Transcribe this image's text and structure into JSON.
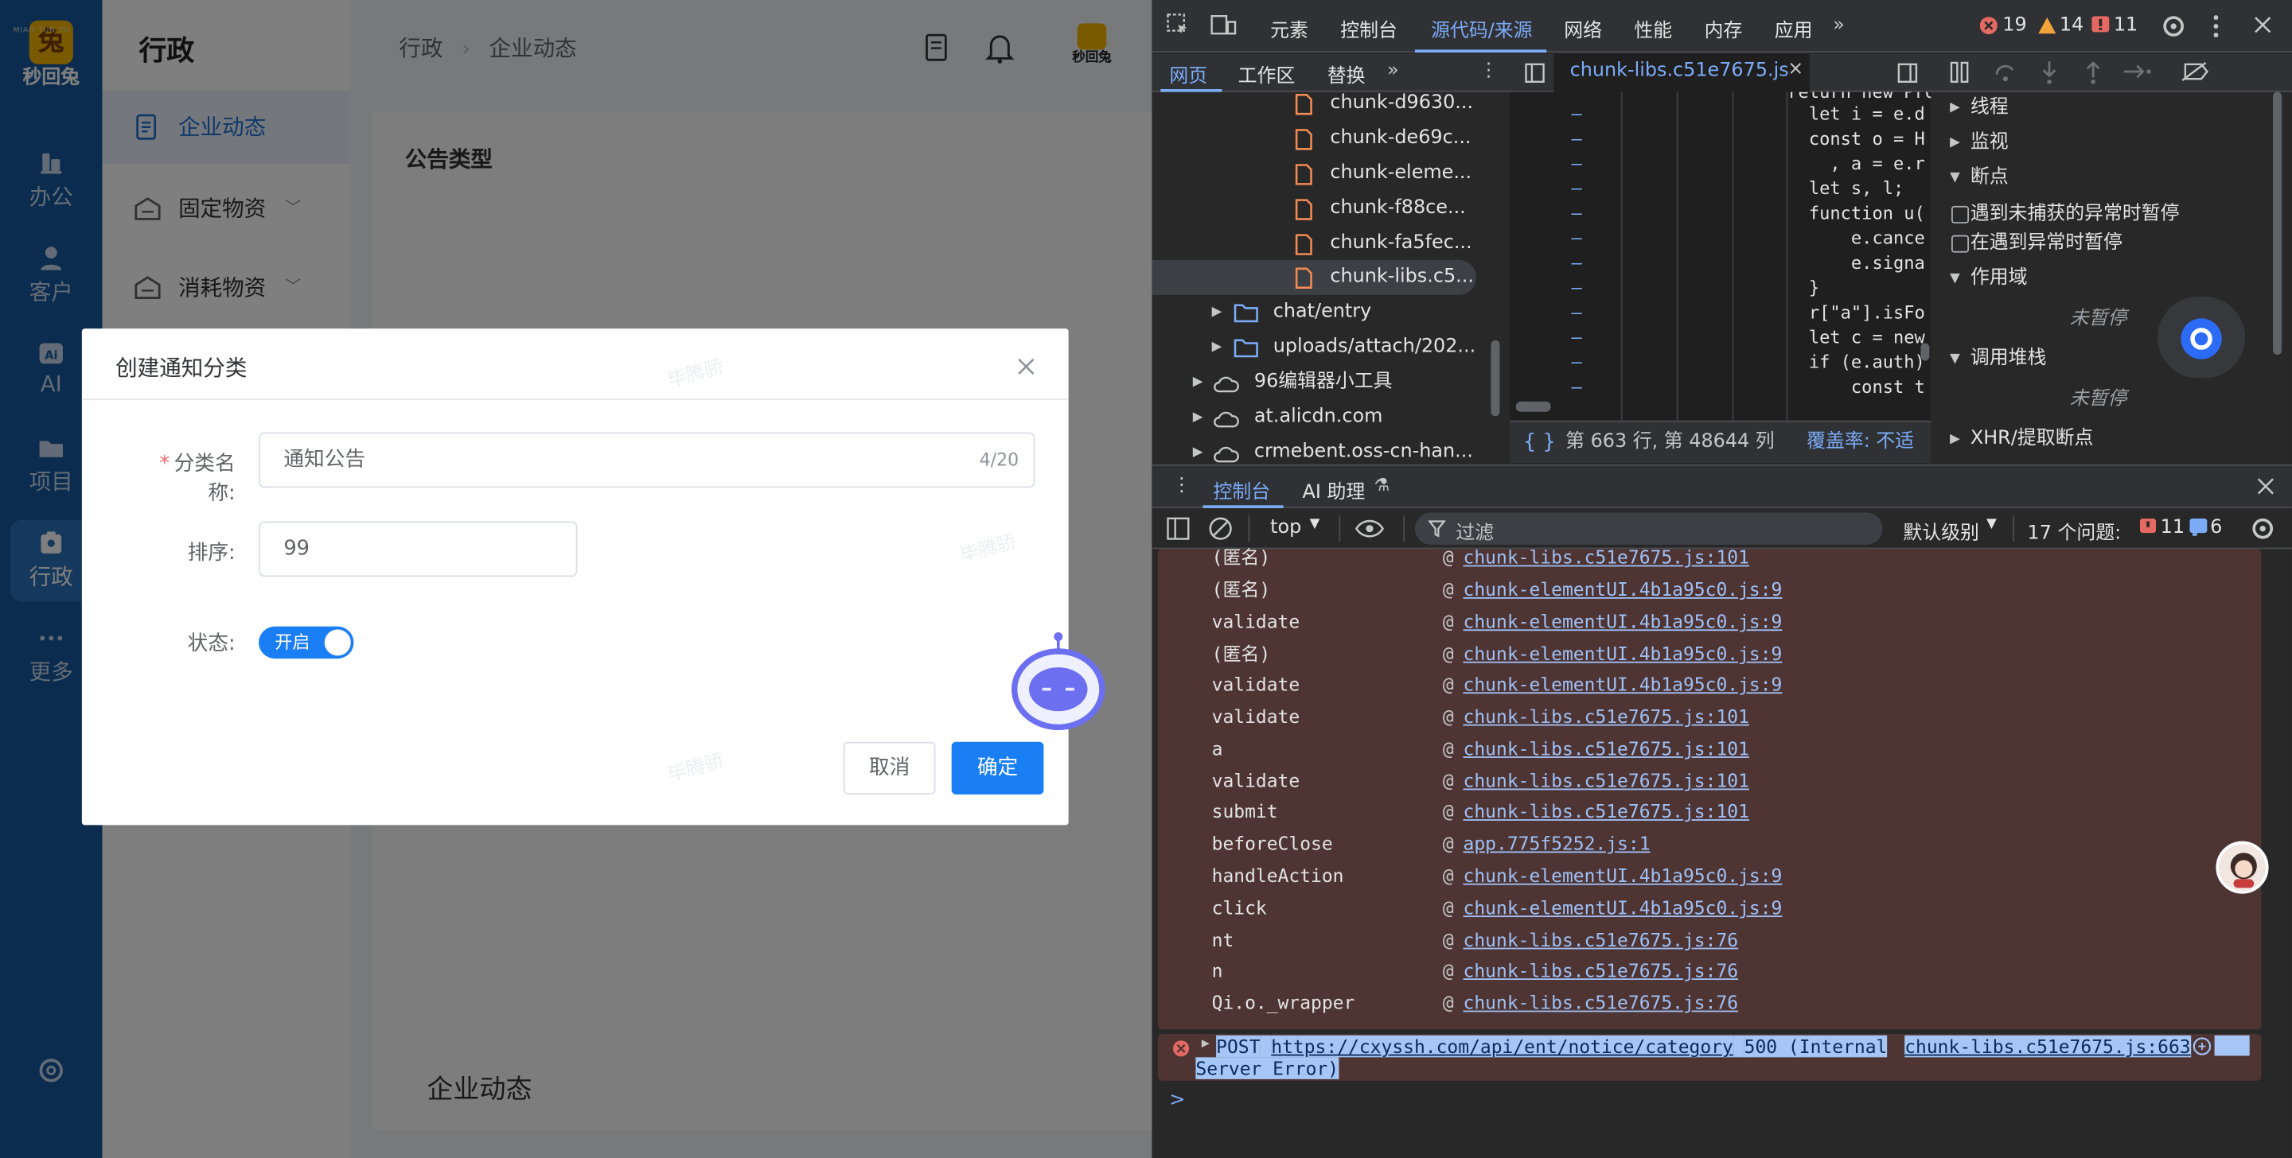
{
  "app": {
    "logo_text": "秒回兔",
    "logo_subtext": "MIAO TUN TU",
    "rail_items": [
      {
        "label": "办公"
      },
      {
        "label": "客户"
      },
      {
        "label": "AI"
      },
      {
        "label": "项目"
      },
      {
        "label": "行政"
      },
      {
        "label": "更多"
      }
    ],
    "section_title": "行政",
    "sidebar_items": [
      {
        "label": "企业动态"
      },
      {
        "label": "固定物资"
      },
      {
        "label": "消耗物资"
      }
    ],
    "breadcrumb": [
      "行政",
      "企业动态"
    ],
    "content_heading": "公告类型",
    "content_bottom": "企业动态",
    "watermark": "毕腾骄"
  },
  "dialog": {
    "title": "创建通知分类",
    "name_label": "分类名称:",
    "name_value": "通知公告",
    "name_count": "4/20",
    "sort_label": "排序:",
    "sort_value": "99",
    "status_label": "状态:",
    "status_value": "开启",
    "cancel": "取消",
    "confirm": "确定"
  },
  "devtools": {
    "tabs": [
      "元素",
      "控制台",
      "源代码/来源",
      "网络",
      "性能",
      "内存",
      "应用"
    ],
    "errors": "19",
    "warnings": "14",
    "issues": "11",
    "sub_tabs": [
      "网页",
      "工作区",
      "替换"
    ],
    "open_file": "chunk-libs.c51e7675.js",
    "file_tree": [
      {
        "name": "chunk-d9630...",
        "kind": "file"
      },
      {
        "name": "chunk-de69c...",
        "kind": "file"
      },
      {
        "name": "chunk-eleme...",
        "kind": "file"
      },
      {
        "name": "chunk-f88ce...",
        "kind": "file"
      },
      {
        "name": "chunk-fa5fec...",
        "kind": "file"
      },
      {
        "name": "chunk-libs.c5...",
        "kind": "file"
      },
      {
        "name": "chat/entry",
        "kind": "folder"
      },
      {
        "name": "uploads/attach/202...",
        "kind": "folder"
      },
      {
        "name": "96编辑器小工具",
        "kind": "cloud"
      },
      {
        "name": "at.alicdn.com",
        "kind": "cloud"
      },
      {
        "name": "crmebent.oss-cn-han...",
        "kind": "cloud"
      }
    ],
    "code_lines": [
      "return new Prom",
      "  let i = e.d",
      "  const o = H",
      "    , a = e.r",
      "  let s, l;",
      "  function u(",
      "      e.cance",
      "      e.signa",
      "  }",
      "  r[\"a\"].isFo",
      "  let c = new",
      "  if (e.auth)",
      "      const t"
    ],
    "status_position": "第 663 行, 第 48644 列",
    "status_coverage": "覆盖率: 不适",
    "debugger": {
      "threads": "线程",
      "watch": "监视",
      "breakpoints": "断点",
      "pause_uncaught": "遇到未捕获的异常时暂停",
      "pause_caught": "在遇到异常时暂停",
      "scope": "作用域",
      "not_paused": "未暂停",
      "call_stack": "调用堆栈",
      "not_paused2": "未暂停",
      "xhr": "XHR/提取断点"
    },
    "drawer_tabs": [
      "控制台",
      "AI 助理"
    ],
    "console_context": "top",
    "console_filter": "过滤",
    "console_level": "默认级别",
    "console_issues": "17 个问题:",
    "console_issue_err": "11",
    "console_issue_info": "6",
    "stack": [
      {
        "fn": "(匿名)",
        "src": "chunk-libs.c51e7675.js:101"
      },
      {
        "fn": "(匿名)",
        "src": "chunk-elementUI.4b1a95c0.js:9"
      },
      {
        "fn": "validate",
        "src": "chunk-elementUI.4b1a95c0.js:9"
      },
      {
        "fn": "(匿名)",
        "src": "chunk-elementUI.4b1a95c0.js:9"
      },
      {
        "fn": "validate",
        "src": "chunk-elementUI.4b1a95c0.js:9"
      },
      {
        "fn": "validate",
        "src": "chunk-libs.c51e7675.js:101"
      },
      {
        "fn": "a",
        "src": "chunk-libs.c51e7675.js:101"
      },
      {
        "fn": "validate",
        "src": "chunk-libs.c51e7675.js:101"
      },
      {
        "fn": "submit",
        "src": "chunk-libs.c51e7675.js:101"
      },
      {
        "fn": "beforeClose",
        "src": "app.775f5252.js:1"
      },
      {
        "fn": "handleAction",
        "src": "chunk-elementUI.4b1a95c0.js:9"
      },
      {
        "fn": "click",
        "src": "chunk-elementUI.4b1a95c0.js:9"
      },
      {
        "fn": "nt",
        "src": "chunk-libs.c51e7675.js:76"
      },
      {
        "fn": "n",
        "src": "chunk-libs.c51e7675.js:76"
      },
      {
        "fn": "Qi.o._wrapper",
        "src": "chunk-libs.c51e7675.js:76"
      }
    ],
    "post_method": "POST",
    "post_url": "https://cxyssh.com/api/ent/notice/category",
    "post_status": "500 (Internal",
    "post_status2": "Server Error)",
    "post_src": "chunk-libs.c51e7675.js:663",
    "prompt": ">"
  },
  "colors": {
    "rail_bg": "#17589c",
    "primary": "#1a7ef5",
    "devtools_accent": "#7cacf8",
    "error_bg": "#4e3534"
  }
}
